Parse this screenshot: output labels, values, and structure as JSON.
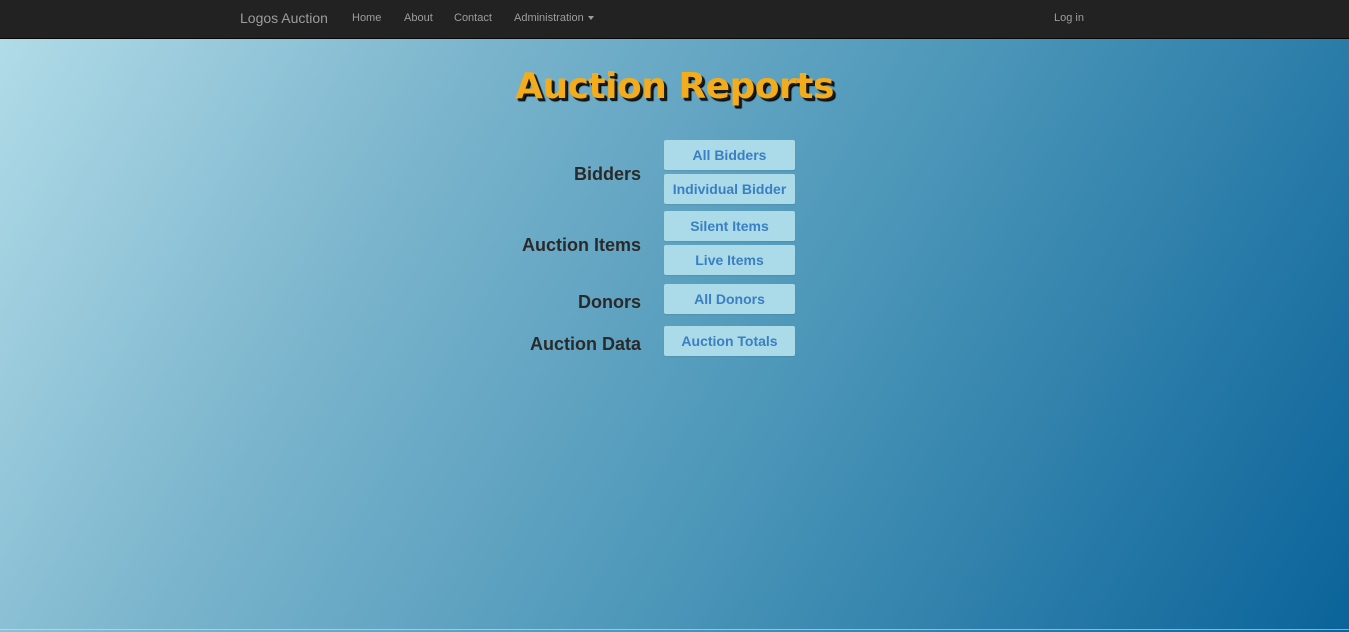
{
  "navbar": {
    "brand": "Logos Auction",
    "links": {
      "home": "Home",
      "about": "About",
      "contact": "Contact",
      "administration": "Administration",
      "login": "Log in"
    }
  },
  "page": {
    "title": "Auction Reports"
  },
  "sections": {
    "bidders": {
      "label": "Bidders",
      "buttons": [
        "All Bidders",
        "Individual Bidder"
      ]
    },
    "auction_items": {
      "label": "Auction Items",
      "buttons": [
        "Silent Items",
        "Live Items"
      ]
    },
    "donors": {
      "label": "Donors",
      "buttons": [
        "All Donors"
      ]
    },
    "auction_data": {
      "label": "Auction Data",
      "buttons": [
        "Auction Totals"
      ]
    }
  },
  "colors": {
    "title": "#f2ac1c",
    "button_bg": "#abdbe8",
    "button_text": "#3a7fc4",
    "navbar_bg": "#222222"
  }
}
